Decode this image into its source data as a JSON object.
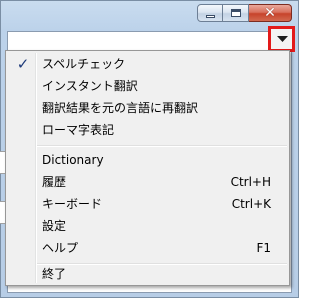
{
  "window": {
    "caption_buttons": {
      "minimize": "minimize-icon",
      "maximize": "maximize-icon",
      "close": "close-icon"
    },
    "dropdown": {
      "icon": "triangle-down-icon",
      "highlight_color": "#e31a1a"
    }
  },
  "menu": {
    "items": [
      {
        "label": "スペルチェック",
        "checked": true
      },
      {
        "label": "インスタント翻訳"
      },
      {
        "label": "翻訳結果を元の言語に再翻訳"
      },
      {
        "label": "ローマ字表記"
      },
      {
        "label": "Dictionary"
      },
      {
        "label": "履歴",
        "shortcut": "Ctrl+H"
      },
      {
        "label": "キーボード",
        "shortcut": "Ctrl+K"
      },
      {
        "label": "設定"
      },
      {
        "label": "ヘルプ",
        "shortcut": "F1"
      },
      {
        "label": "終了"
      }
    ],
    "check_glyph": "✓"
  }
}
